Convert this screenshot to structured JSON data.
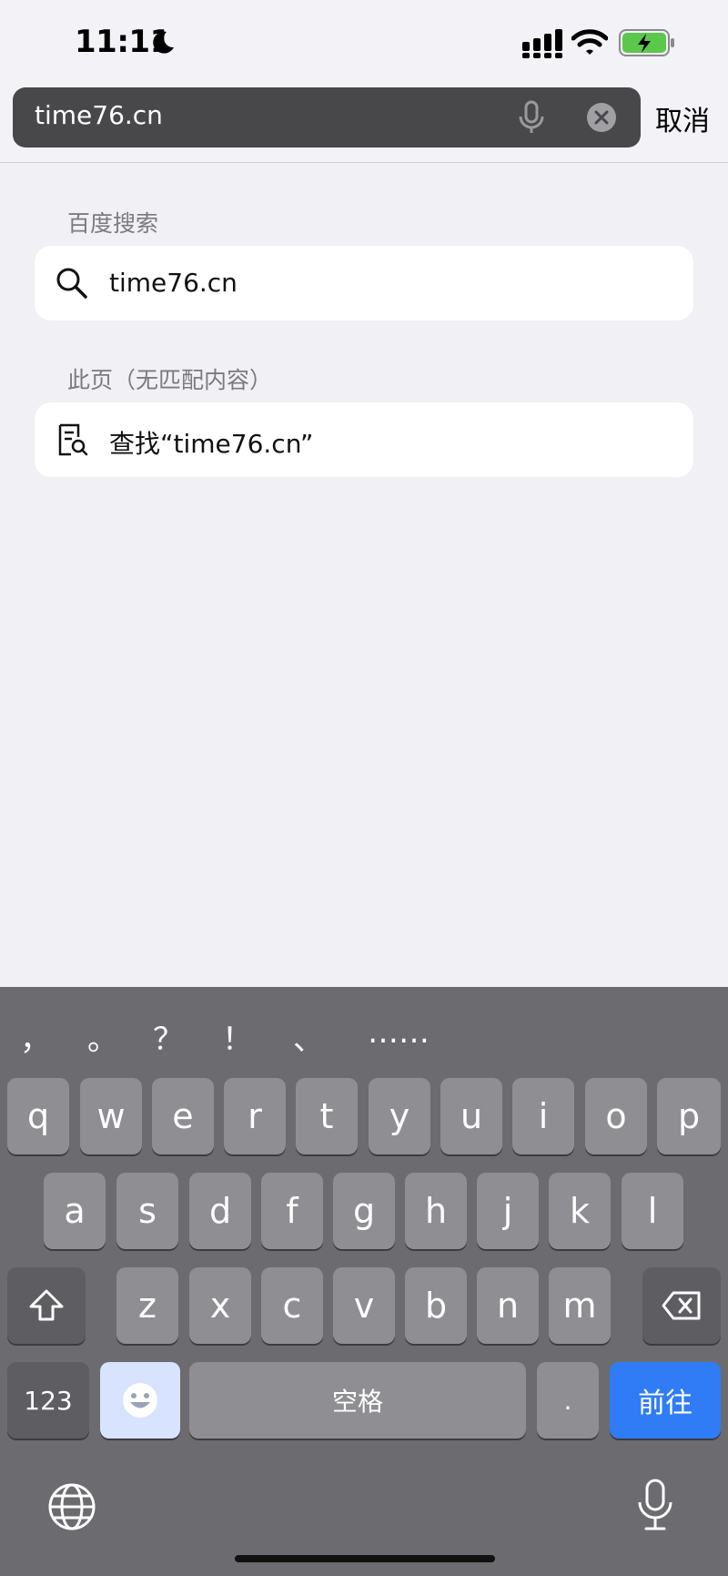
{
  "status_bar": {
    "time": "11:11",
    "icons": [
      "moon-icon",
      "cellular-signal-icon",
      "wifi-icon",
      "battery-charging-icon"
    ],
    "battery_color": "#5ac84b"
  },
  "search": {
    "url_value": "time76.cn",
    "cancel_label": "取消",
    "icons": [
      "microphone-icon",
      "clear-icon"
    ]
  },
  "suggestions": {
    "baidu_header": "百度搜索",
    "baidu_query": "time76.cn",
    "page_header": "此页（无匹配内容）",
    "find_query": "查找“time76.cn”"
  },
  "keyboard": {
    "punctuation": [
      "，",
      "。",
      "？",
      "！",
      "、",
      "……"
    ],
    "row1": [
      "q",
      "w",
      "e",
      "r",
      "t",
      "y",
      "u",
      "i",
      "o",
      "p"
    ],
    "row2": [
      "a",
      "s",
      "d",
      "f",
      "g",
      "h",
      "j",
      "k",
      "l"
    ],
    "row3": [
      "z",
      "x",
      "c",
      "v",
      "b",
      "n",
      "m"
    ],
    "numbers_label": "123",
    "space_label": "空格",
    "period_label": ".",
    "go_label": "前往",
    "go_color": "#2f7cf6",
    "icons": [
      "shift-icon",
      "delete-icon",
      "emoji-icon",
      "globe-icon",
      "dictation-mic-icon"
    ]
  }
}
